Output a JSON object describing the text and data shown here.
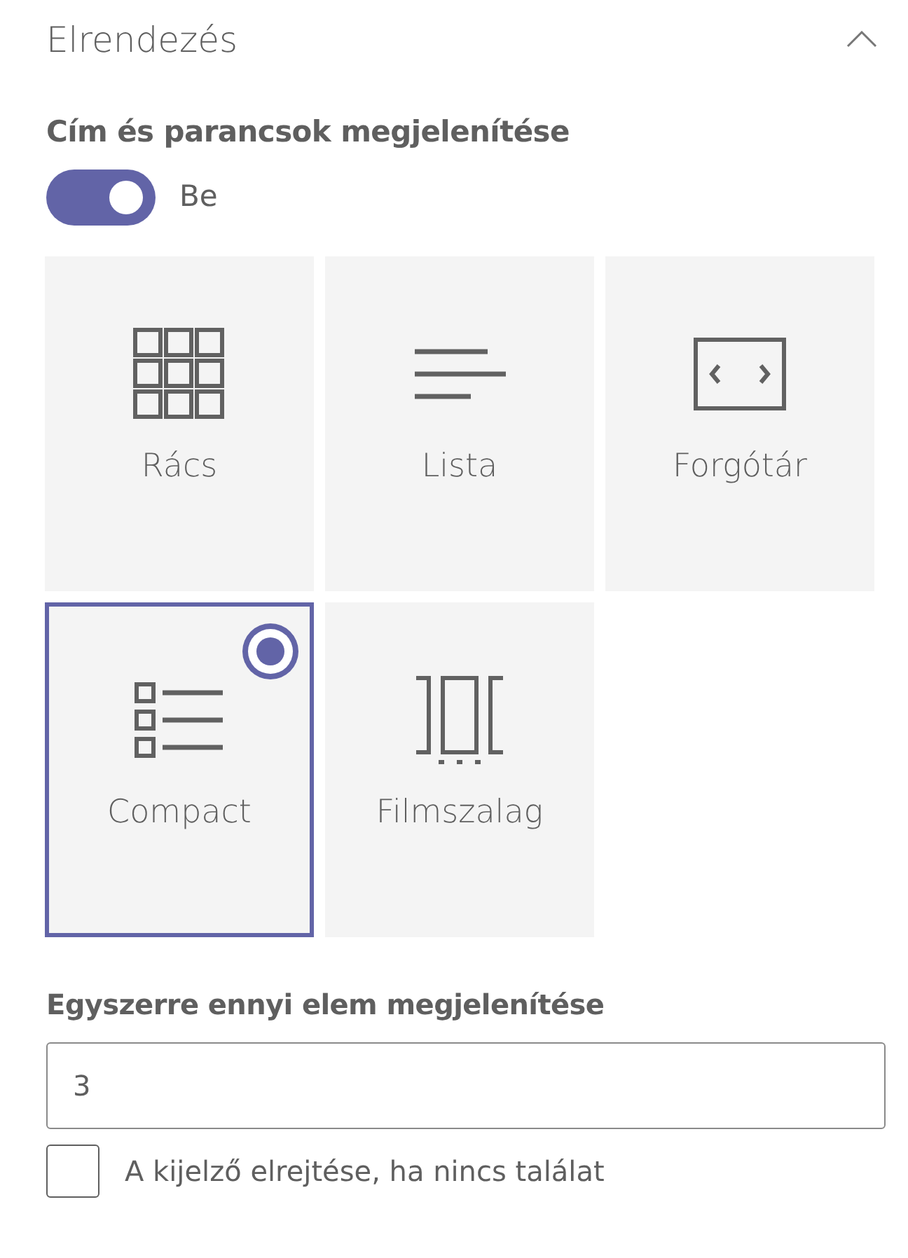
{
  "section": {
    "title": "Elrendezés",
    "expanded": true
  },
  "show_title_toggle": {
    "label": "Cím és parancsok megjelenítése",
    "on": true,
    "state_text": "Be"
  },
  "layouts": [
    {
      "kind": "grid",
      "label": "Rács",
      "selected": false
    },
    {
      "kind": "list",
      "label": "Lista",
      "selected": false
    },
    {
      "kind": "carousel",
      "label": "Forgótár",
      "selected": false
    },
    {
      "kind": "compact",
      "label": "Compact",
      "selected": true
    },
    {
      "kind": "filmstrip",
      "label": "Filmszalag",
      "selected": false
    }
  ],
  "items_count": {
    "label": "Egyszerre ennyi elem megjelenítése",
    "value": "3"
  },
  "hide_if_empty": {
    "label": "A kijelző elrejtése, ha nincs találat",
    "checked": false
  }
}
